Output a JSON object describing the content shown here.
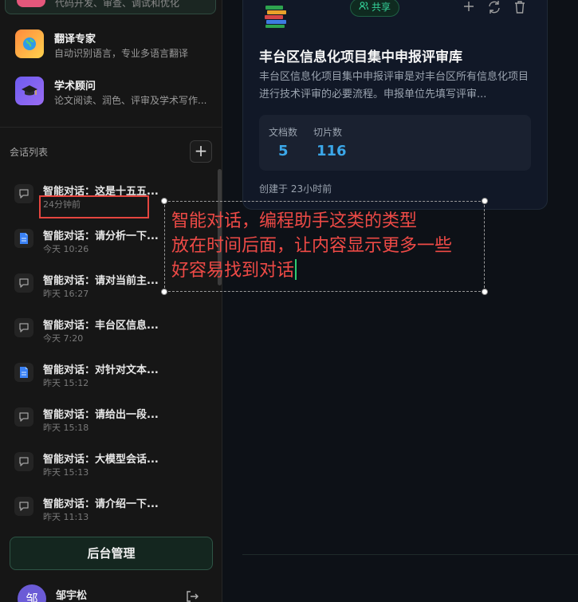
{
  "sidebar": {
    "top_card": {
      "desc": "代码开发、审查、调试和优化"
    },
    "agents": [
      {
        "name": "翻译专家",
        "desc": "自动识别语言，专业多语言翻译"
      },
      {
        "name": "学术顾问",
        "desc": "论文阅读、润色、评审及学术写作..."
      }
    ],
    "conversations_title": "会话列表",
    "add_label": "+",
    "conversations": [
      {
        "title": "智能对话：这是十五五...",
        "time": "24分钟前",
        "icon": "chat-icon"
      },
      {
        "title": "智能对话：请分析一下...",
        "time": "今天 10:26",
        "icon": "document-icon"
      },
      {
        "title": "智能对话：请对当前主...",
        "time": "昨天 16:27",
        "icon": "chat-icon"
      },
      {
        "title": "智能对话：丰台区信息...",
        "time": "今天 7:20",
        "icon": "chat-icon"
      },
      {
        "title": "智能对话：对针对文本...",
        "time": "昨天 15:12",
        "icon": "document-icon"
      },
      {
        "title": "智能对话：请给出一段...",
        "time": "昨天 15:18",
        "icon": "chat-icon"
      },
      {
        "title": "智能对话：大模型会话...",
        "time": "昨天 15:13",
        "icon": "chat-icon"
      },
      {
        "title": "智能对话：请介绍一下...",
        "time": "昨天 11:13",
        "icon": "chat-icon"
      }
    ],
    "admin_button": "后台管理",
    "user": {
      "avatar": "邹",
      "name": "邹宇松"
    }
  },
  "kb_card": {
    "share_label": "共享",
    "title": "丰台区信息化项目集中申报评审库",
    "description": "丰台区信息化项目集中申报评审是对丰台区所有信息化项目进行技术评审的必要流程。申报单位先填写评审...",
    "stats": [
      {
        "label": "文档数",
        "value": "5"
      },
      {
        "label": "切片数",
        "value": "116"
      }
    ],
    "created": "创建于 23小时前"
  },
  "annotation": {
    "lines": [
      "智能对话，编程助手这类的类型",
      "放在时间后面，让内容显示更多一些",
      "好容易找到对话"
    ],
    "color": "#ee4a46"
  },
  "colors": {
    "accent": "#34d399",
    "stat_value": "#3ba7e8",
    "annotation_red": "#e5453f"
  }
}
